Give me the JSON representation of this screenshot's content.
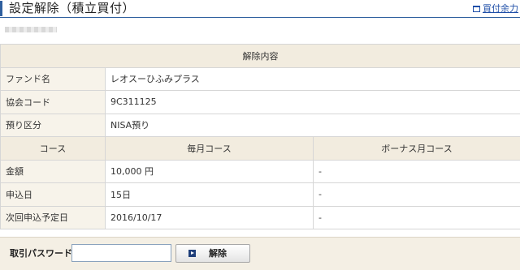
{
  "header": {
    "title": "設定解除（積立買付）",
    "link_label": "買付余力"
  },
  "table": {
    "section_title": "解除内容",
    "rows_top": [
      {
        "label": "ファンド名",
        "value": "レオスーひふみプラス"
      },
      {
        "label": "協会コード",
        "value": "9C311125"
      },
      {
        "label": "預り区分",
        "value": "NISA預り"
      }
    ],
    "course_header": {
      "label": "コース",
      "monthly": "毎月コース",
      "bonus": "ボーナス月コース"
    },
    "rows_course": [
      {
        "label": "金額",
        "monthly": "10,000 円",
        "bonus": "-"
      },
      {
        "label": "申込日",
        "monthly": "15日",
        "bonus": "-"
      },
      {
        "label": "次回申込予定日",
        "monthly": "2016/10/17",
        "bonus": "-"
      }
    ]
  },
  "footer": {
    "password_label": "取引パスワード：",
    "password_value": "",
    "submit_label": "解除"
  }
}
